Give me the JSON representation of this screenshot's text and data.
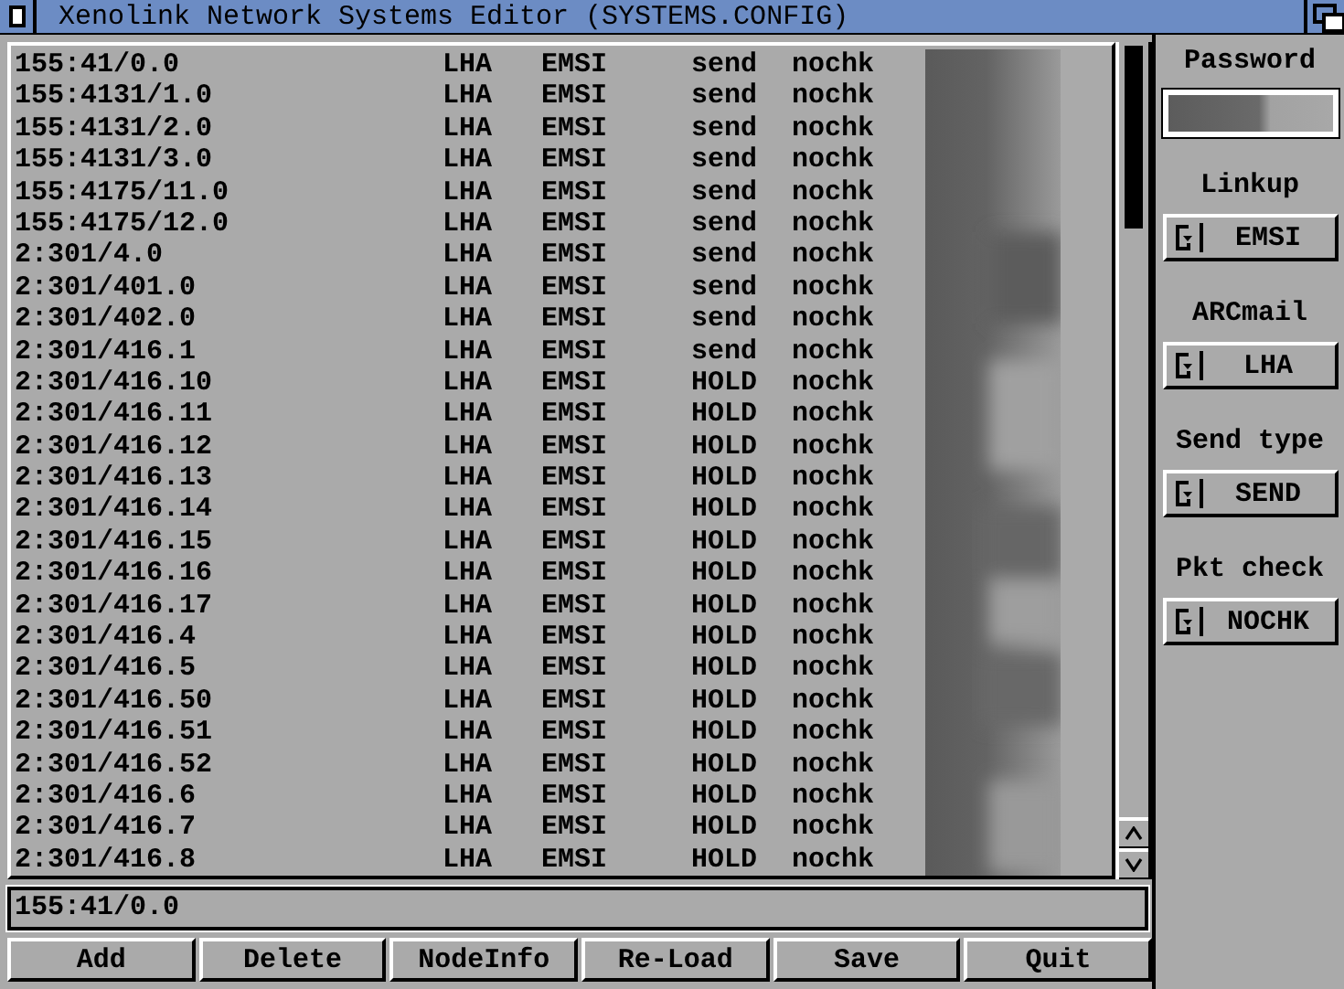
{
  "window": {
    "title": "Xenolink Network Systems Editor (SYSTEMS.CONFIG)"
  },
  "nodes": [
    {
      "address": "155:41/0.0",
      "arcmail": "LHA",
      "linkup": "EMSI",
      "send_type": "send",
      "pkt_check": "nochk"
    },
    {
      "address": "155:4131/1.0",
      "arcmail": "LHA",
      "linkup": "EMSI",
      "send_type": "send",
      "pkt_check": "nochk"
    },
    {
      "address": "155:4131/2.0",
      "arcmail": "LHA",
      "linkup": "EMSI",
      "send_type": "send",
      "pkt_check": "nochk"
    },
    {
      "address": "155:4131/3.0",
      "arcmail": "LHA",
      "linkup": "EMSI",
      "send_type": "send",
      "pkt_check": "nochk"
    },
    {
      "address": "155:4175/11.0",
      "arcmail": "LHA",
      "linkup": "EMSI",
      "send_type": "send",
      "pkt_check": "nochk"
    },
    {
      "address": "155:4175/12.0",
      "arcmail": "LHA",
      "linkup": "EMSI",
      "send_type": "send",
      "pkt_check": "nochk"
    },
    {
      "address": "2:301/4.0",
      "arcmail": "LHA",
      "linkup": "EMSI",
      "send_type": "send",
      "pkt_check": "nochk"
    },
    {
      "address": "2:301/401.0",
      "arcmail": "LHA",
      "linkup": "EMSI",
      "send_type": "send",
      "pkt_check": "nochk"
    },
    {
      "address": "2:301/402.0",
      "arcmail": "LHA",
      "linkup": "EMSI",
      "send_type": "send",
      "pkt_check": "nochk"
    },
    {
      "address": "2:301/416.1",
      "arcmail": "LHA",
      "linkup": "EMSI",
      "send_type": "send",
      "pkt_check": "nochk"
    },
    {
      "address": "2:301/416.10",
      "arcmail": "LHA",
      "linkup": "EMSI",
      "send_type": "HOLD",
      "pkt_check": "nochk"
    },
    {
      "address": "2:301/416.11",
      "arcmail": "LHA",
      "linkup": "EMSI",
      "send_type": "HOLD",
      "pkt_check": "nochk"
    },
    {
      "address": "2:301/416.12",
      "arcmail": "LHA",
      "linkup": "EMSI",
      "send_type": "HOLD",
      "pkt_check": "nochk"
    },
    {
      "address": "2:301/416.13",
      "arcmail": "LHA",
      "linkup": "EMSI",
      "send_type": "HOLD",
      "pkt_check": "nochk"
    },
    {
      "address": "2:301/416.14",
      "arcmail": "LHA",
      "linkup": "EMSI",
      "send_type": "HOLD",
      "pkt_check": "nochk"
    },
    {
      "address": "2:301/416.15",
      "arcmail": "LHA",
      "linkup": "EMSI",
      "send_type": "HOLD",
      "pkt_check": "nochk"
    },
    {
      "address": "2:301/416.16",
      "arcmail": "LHA",
      "linkup": "EMSI",
      "send_type": "HOLD",
      "pkt_check": "nochk"
    },
    {
      "address": "2:301/416.17",
      "arcmail": "LHA",
      "linkup": "EMSI",
      "send_type": "HOLD",
      "pkt_check": "nochk"
    },
    {
      "address": "2:301/416.4",
      "arcmail": "LHA",
      "linkup": "EMSI",
      "send_type": "HOLD",
      "pkt_check": "nochk"
    },
    {
      "address": "2:301/416.5",
      "arcmail": "LHA",
      "linkup": "EMSI",
      "send_type": "HOLD",
      "pkt_check": "nochk"
    },
    {
      "address": "2:301/416.50",
      "arcmail": "LHA",
      "linkup": "EMSI",
      "send_type": "HOLD",
      "pkt_check": "nochk"
    },
    {
      "address": "2:301/416.51",
      "arcmail": "LHA",
      "linkup": "EMSI",
      "send_type": "HOLD",
      "pkt_check": "nochk"
    },
    {
      "address": "2:301/416.52",
      "arcmail": "LHA",
      "linkup": "EMSI",
      "send_type": "HOLD",
      "pkt_check": "nochk"
    },
    {
      "address": "2:301/416.6",
      "arcmail": "LHA",
      "linkup": "EMSI",
      "send_type": "HOLD",
      "pkt_check": "nochk"
    },
    {
      "address": "2:301/416.7",
      "arcmail": "LHA",
      "linkup": "EMSI",
      "send_type": "HOLD",
      "pkt_check": "nochk"
    },
    {
      "address": "2:301/416.8",
      "arcmail": "LHA",
      "linkup": "EMSI",
      "send_type": "HOLD",
      "pkt_check": "nochk"
    }
  ],
  "side_panel": {
    "password": {
      "label": "Password"
    },
    "cycles": [
      {
        "label": "Linkup",
        "value": "EMSI"
      },
      {
        "label": "ARCmail",
        "value": "LHA"
      },
      {
        "label": "Send type",
        "value": "SEND"
      },
      {
        "label": "Pkt check",
        "value": "NOCHK"
      }
    ]
  },
  "address_field": {
    "value": "155:41/0.0"
  },
  "buttons": [
    "Add",
    "Delete",
    "NodeInfo",
    "Re-Load",
    "Save",
    "Quit"
  ]
}
